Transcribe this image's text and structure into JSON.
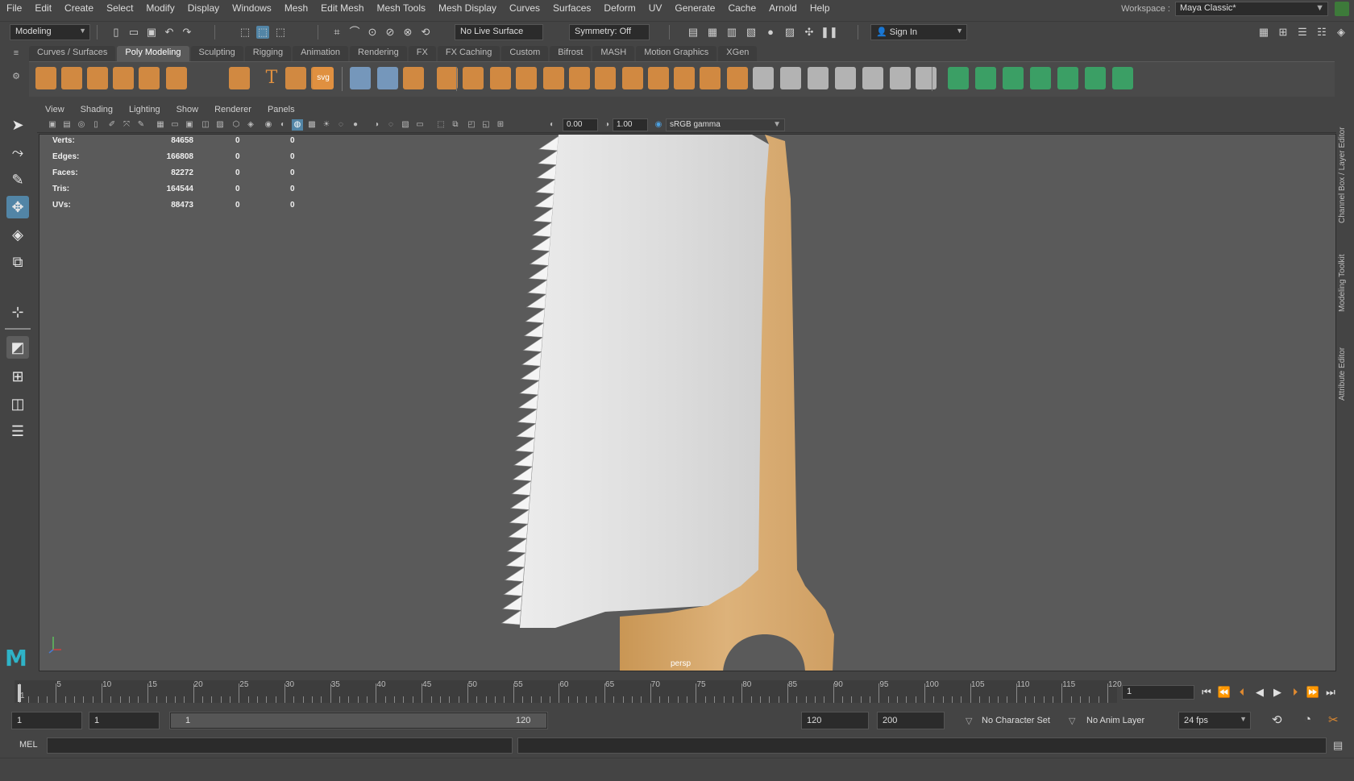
{
  "menu": {
    "items": [
      "File",
      "Edit",
      "Create",
      "Select",
      "Modify",
      "Display",
      "Windows",
      "Mesh",
      "Edit Mesh",
      "Mesh Tools",
      "Mesh Display",
      "Curves",
      "Surfaces",
      "Deform",
      "UV",
      "Generate",
      "Cache",
      "Arnold",
      "Help"
    ]
  },
  "workspace": {
    "label": "Workspace :",
    "value": "Maya Classic*"
  },
  "statusline": {
    "menuset": "Modeling",
    "live_surface": "No Live Surface",
    "symmetry": "Symmetry: Off",
    "sign_in": "Sign In"
  },
  "shelf": {
    "tabs": [
      "Curves / Surfaces",
      "Poly Modeling",
      "Sculpting",
      "Rigging",
      "Animation",
      "Rendering",
      "FX",
      "FX Caching",
      "Custom",
      "Bifrost",
      "MASH",
      "Motion Graphics",
      "XGen"
    ],
    "active_tab": "Poly Modeling",
    "svg_label": "svg",
    "text_label": "T",
    "icons": [
      "sphere-icon",
      "cube-icon",
      "cylinder-icon",
      "cone-icon",
      "torus-icon",
      "plane-icon",
      "disc-icon",
      "platonic-icon",
      "super-shape-icon",
      "text-icon",
      "svg-icon",
      "measure-icon",
      "type-icon",
      "center-pivot-icon",
      "combine-icon",
      "separate-icon",
      "smooth-icon",
      "extrude-icon",
      "bridge-icon",
      "bevel-icon",
      "merge-icon",
      "fill-hole-icon",
      "append-icon",
      "multicut-icon",
      "insert-loop-icon",
      "target-weld-icon",
      "uv-icon"
    ]
  },
  "panel": {
    "menus": [
      "View",
      "Shading",
      "Lighting",
      "Show",
      "Renderer",
      "Panels"
    ],
    "exposure": "0.00",
    "gamma": "1.00",
    "color_space": "sRGB gamma",
    "camera": "persp"
  },
  "hud": [
    {
      "label": "Verts:",
      "v1": "84658",
      "v2": "0",
      "v3": "0"
    },
    {
      "label": "Edges:",
      "v1": "166808",
      "v2": "0",
      "v3": "0"
    },
    {
      "label": "Faces:",
      "v1": "82272",
      "v2": "0",
      "v3": "0"
    },
    {
      "label": "Tris:",
      "v1": "164544",
      "v2": "0",
      "v3": "0"
    },
    {
      "label": "UVs:",
      "v1": "88473",
      "v2": "0",
      "v3": "0"
    }
  ],
  "right_tabs": [
    "Channel Box / Layer Editor",
    "Modeling Toolkit",
    "Attribute Editor"
  ],
  "timeline": {
    "labels": [
      "1",
      "5",
      "10",
      "15",
      "20",
      "25",
      "30",
      "35",
      "40",
      "45",
      "50",
      "55",
      "60",
      "65",
      "70",
      "75",
      "80",
      "85",
      "90",
      "95",
      "100",
      "105",
      "110",
      "115",
      "120"
    ],
    "current_frame": "1"
  },
  "range": {
    "start": "1",
    "playback_start": "1",
    "range_start": "1",
    "range_end": "120",
    "playback_end": "120",
    "end": "200",
    "character_set": "No Character Set",
    "anim_layer": "No Anim Layer",
    "fps": "24 fps"
  },
  "command": {
    "label": "MEL"
  },
  "colors": {
    "blade": "#e6e6e6",
    "handle": "#d8a868",
    "viewport_bg": "#5a5a5a",
    "shelf_orange": "#e09040",
    "shelf_green": "#3aa868",
    "active_tool": "#5285a6"
  }
}
